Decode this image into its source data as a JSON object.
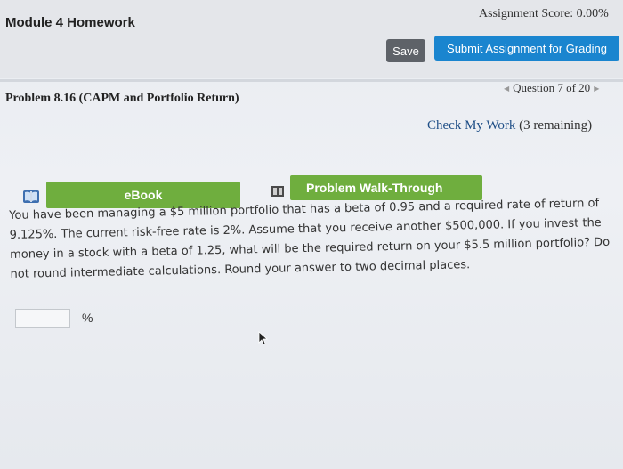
{
  "header": {
    "module_title": "Module 4 Homework",
    "assignment_score": "Assignment Score: 0.00%",
    "save_label": "Save",
    "submit_label": "Submit Assignment for Grading"
  },
  "problem": {
    "title": "Problem 8.16 (CAPM and Portfolio Return)",
    "question_nav": "Question 7 of 20",
    "check_work": "Check My Work",
    "check_work_remaining": "(3 remaining)"
  },
  "resources": {
    "ebook_label": "eBook",
    "walkthrough_label": "Problem Walk-Through"
  },
  "question": {
    "text": "You have been managing a $5 million portfolio that has a beta of 0.95 and a required rate of return of 9.125%. The current risk-free rate is 2%. Assume that you receive another $500,000. If you invest the money in a stock with a beta of 1.25, what will be the required return on your $5.5 million portfolio? Do not round intermediate calculations. Round your answer to two decimal places.",
    "answer_value": "",
    "unit": "%"
  },
  "colors": {
    "submit_blue": "#1a85cf",
    "save_gray": "#5e6268",
    "resource_green": "#6fae3e",
    "link_blue": "#1f4f87"
  },
  "icons": {
    "book": "book-icon",
    "walkthrough": "walkthrough-icon",
    "prev": "chevron-left-icon",
    "next": "chevron-right-icon",
    "cursor": "mouse-cursor-icon"
  }
}
